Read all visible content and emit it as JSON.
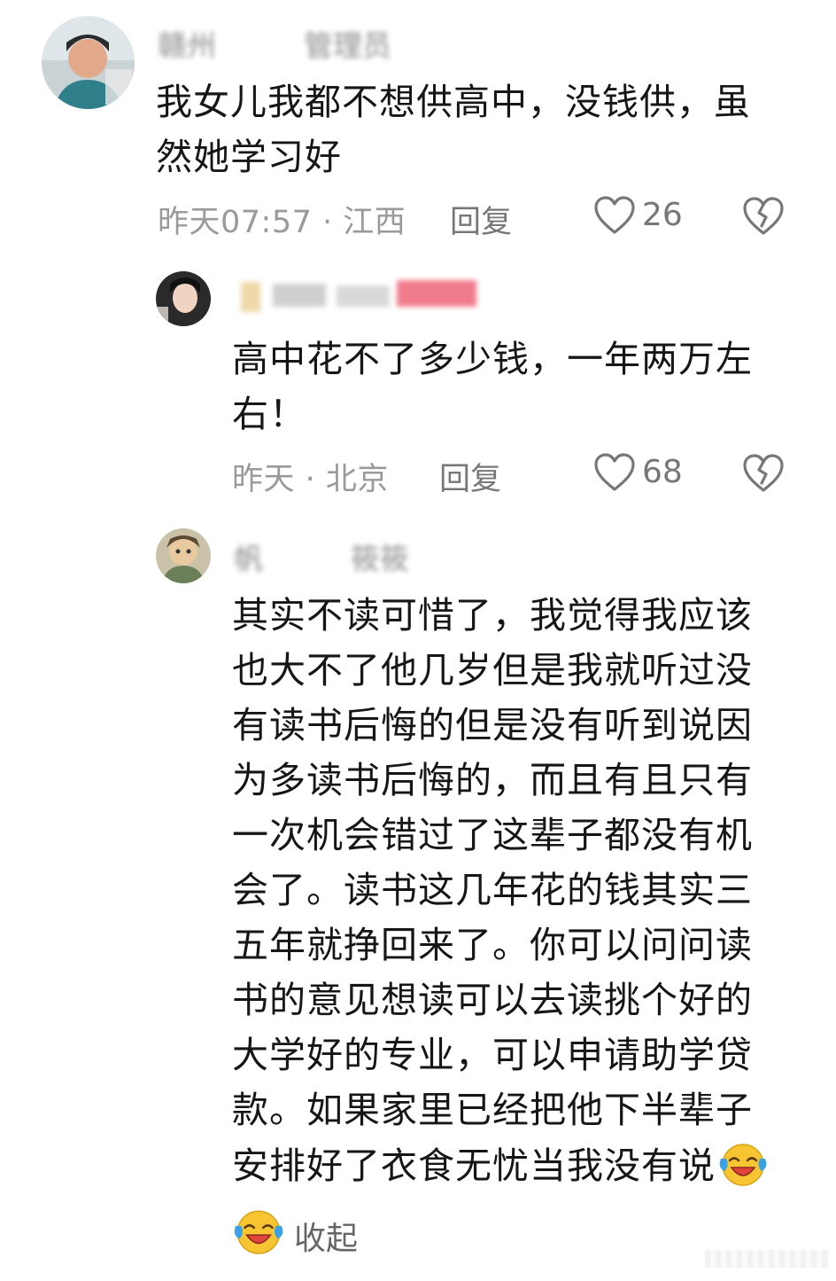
{
  "comments": [
    {
      "username": "赣州　　　管理员",
      "text": "我女儿我都不想供高中，没钱供，虽然她学习好",
      "time_location": "昨天07:57 · 江西",
      "reply_label": "回复",
      "likes": "26"
    },
    {
      "username": "　　　　　",
      "text": "高中花不了多少钱，一年两万左右！",
      "time_location": "昨天 · 北京",
      "reply_label": "回复",
      "likes": "68"
    },
    {
      "username": "帆　　　筱筱",
      "text": "其实不读可惜了，我觉得我应该也大不了他几岁但是我就听过没有读书后悔的但是没有听到说因为多读书后悔的，而且有且只有一次机会错过了这辈子都没有机会了。读书这几年花的钱其实三五年就挣回来了。你可以问问读书的意见想读可以去读挑个好的大学好的专业，可以申请助学贷款。如果家里已经把他下半辈子安排好了衣食无忧当我没有说",
      "collapse_label": "收起"
    }
  ],
  "icons": {
    "like": "heart-outline-icon",
    "dislike": "broken-heart-icon",
    "emoji": "laughing-crying-emoji-icon"
  },
  "colors": {
    "text": "#161616",
    "meta": "#9a9a9a",
    "icon": "#777777",
    "emoji_face": "#f7c531",
    "emoji_tear": "#3aa1e8",
    "emoji_mouth": "#e0443b"
  }
}
